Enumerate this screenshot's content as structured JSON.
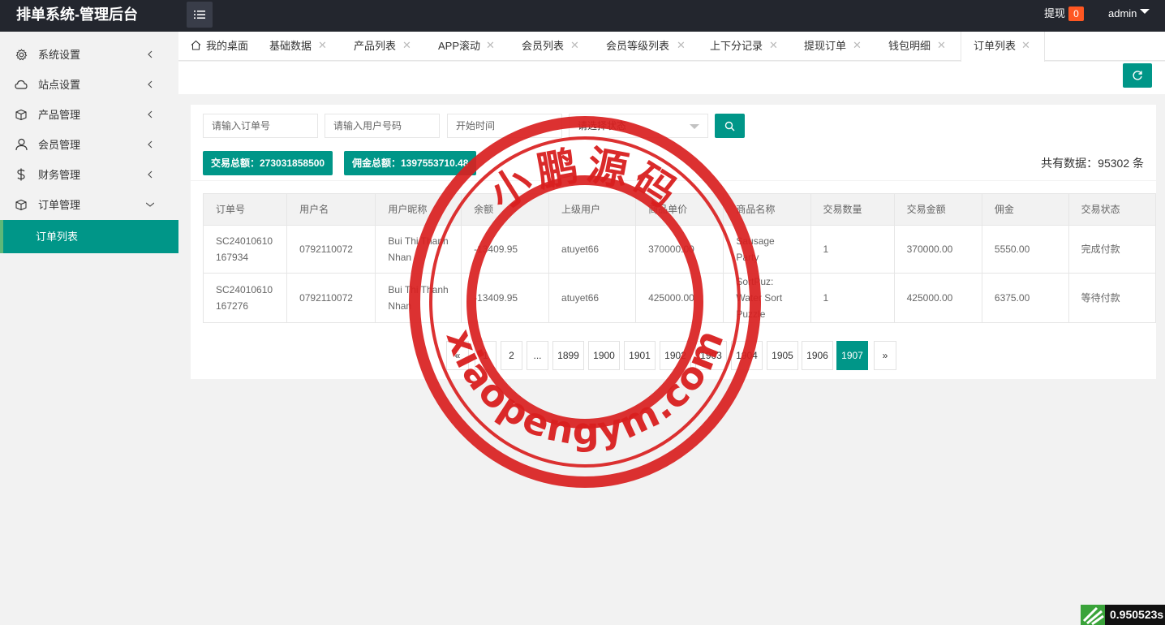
{
  "header": {
    "title": "排单系统-管理后台",
    "menu_icon": "list-icon",
    "withdraw_label": "提现",
    "withdraw_count": "0",
    "user": "admin"
  },
  "sidebar": {
    "items": [
      {
        "label": "系统设置",
        "icon": "gear-icon"
      },
      {
        "label": "站点设置",
        "icon": "cloud-icon"
      },
      {
        "label": "产品管理",
        "icon": "box-icon"
      },
      {
        "label": "会员管理",
        "icon": "user-icon"
      },
      {
        "label": "财务管理",
        "icon": "dollar-icon"
      },
      {
        "label": "订单管理",
        "icon": "cart-icon"
      }
    ],
    "active_sub": "订单列表"
  },
  "tabs": [
    {
      "label": "我的桌面"
    },
    {
      "label": "基础数据"
    },
    {
      "label": "产品列表"
    },
    {
      "label": "APP滚动"
    },
    {
      "label": "会员列表"
    },
    {
      "label": "会员等级列表"
    },
    {
      "label": "上下分记录"
    },
    {
      "label": "提现订单"
    },
    {
      "label": "钱包明细"
    },
    {
      "label": "订单列表"
    }
  ],
  "filters": {
    "order_placeholder": "请输入订单号",
    "phone_placeholder": "请输入用户号码",
    "time_placeholder": "开始时间",
    "status_select": "请选择状态"
  },
  "stats": {
    "trade_total": "交易总额：273031858500",
    "commission_total": "佣金总额：1397553710.48",
    "record_count": "共有数据：95302 条"
  },
  "table": {
    "headers": [
      "订单号",
      "用户名",
      "用户昵称",
      "余额",
      "上级用户",
      "商品单价",
      "商品名称",
      "交易数量",
      "交易金额",
      "佣金",
      "交易状态"
    ],
    "rows": [
      {
        "order_no": "SC24010610167934",
        "username": "0792110072",
        "nickname": "Bui Thi Thanh Nhan",
        "balance": "-13409.95",
        "parent": "atuyet66",
        "price": "370000.00",
        "product": "Sausage Party",
        "qty": "1",
        "amount": "370000.00",
        "commission": "5550.00",
        "status": "完成付款"
      },
      {
        "order_no": "SC24010610167276",
        "username": "0792110072",
        "nickname": "Bui Thi Thanh Nhan",
        "balance": "-13409.95",
        "parent": "atuyet66",
        "price": "425000.00",
        "product": "SortPuz: Water Sort Puzzle",
        "qty": "1",
        "amount": "425000.00",
        "commission": "6375.00",
        "status": "等待付款"
      }
    ]
  },
  "pagination": {
    "prev": "«",
    "pages": [
      "1",
      "2",
      "...",
      "1899",
      "1900",
      "1901",
      "1902",
      "1903",
      "1904",
      "1905",
      "1906",
      "1907"
    ],
    "active": "1907",
    "next": "»"
  },
  "watermark": {
    "cn_text": "小鹏源码",
    "url_text": "xiaopengym.com",
    "color": "#d91f1f"
  },
  "timer": "0.950523s",
  "colors": {
    "accent": "#009688",
    "header_bg": "#23262e",
    "badge": "#ff5722"
  }
}
